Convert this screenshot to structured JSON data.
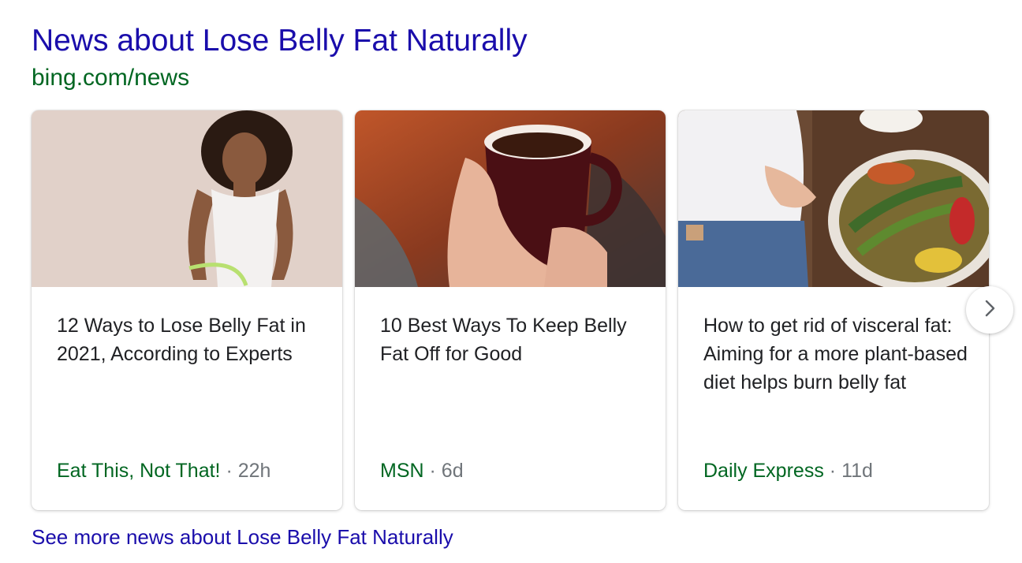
{
  "header": {
    "title": "News about Lose Belly Fat Naturally",
    "source": "bing.com/news"
  },
  "cards": [
    {
      "image": "woman-measuring-waist-image",
      "title": "12 Ways to Lose Belly Fat in 2021, According to Experts",
      "publisher": "Eat This, Not That!",
      "separator": "·",
      "age": "22h"
    },
    {
      "image": "hands-holding-tea-mug-image",
      "title": "10 Best Ways To Keep Belly Fat Off for Good",
      "publisher": "MSN",
      "separator": "·",
      "age": "6d"
    },
    {
      "image": "belly-and-vegetable-platter-image",
      "title": "How to get rid of visceral fat: Aiming for a more plant-based diet helps burn belly fat",
      "publisher": "Daily Express",
      "separator": "·",
      "age": "11d"
    }
  ],
  "carousel": {
    "next_icon": "chevron-right-icon"
  },
  "footer": {
    "see_more": "See more news about Lose Belly Fat Naturally"
  },
  "colors": {
    "link": "#1a0dab",
    "url_green": "#006621",
    "meta_gray": "#70757a",
    "text": "#202124"
  }
}
